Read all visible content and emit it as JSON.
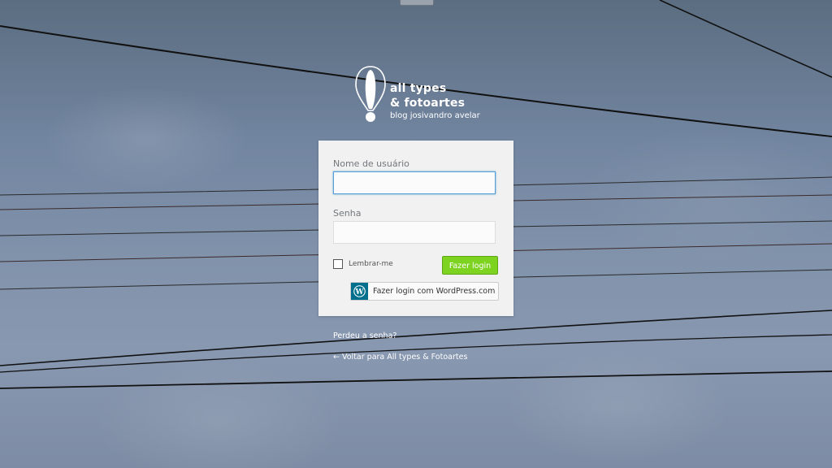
{
  "brand": {
    "title_line1": "all types",
    "title_line2": "& fotoartes",
    "subtitle": "blog josivandro avelar"
  },
  "login": {
    "username_label": "Nome de usuário",
    "username_value": "",
    "password_label": "Senha",
    "password_value": "",
    "remember_label": "Lembrar-me",
    "remember_checked": false,
    "submit_label": "Fazer login",
    "wp_login_label": "Fazer login com WordPress.com"
  },
  "links": {
    "lost_password": "Perdeu a senha?",
    "back_to_site": "← Voltar para All types & Fotoartes"
  },
  "colors": {
    "submit_button": "#7ed321",
    "wordpress_icon_bg": "#006e8d",
    "focus_border": "#5b9dd9"
  },
  "icons": {
    "logo": "exclamation-balloon-logo",
    "wordpress": "wordpress-logo"
  }
}
